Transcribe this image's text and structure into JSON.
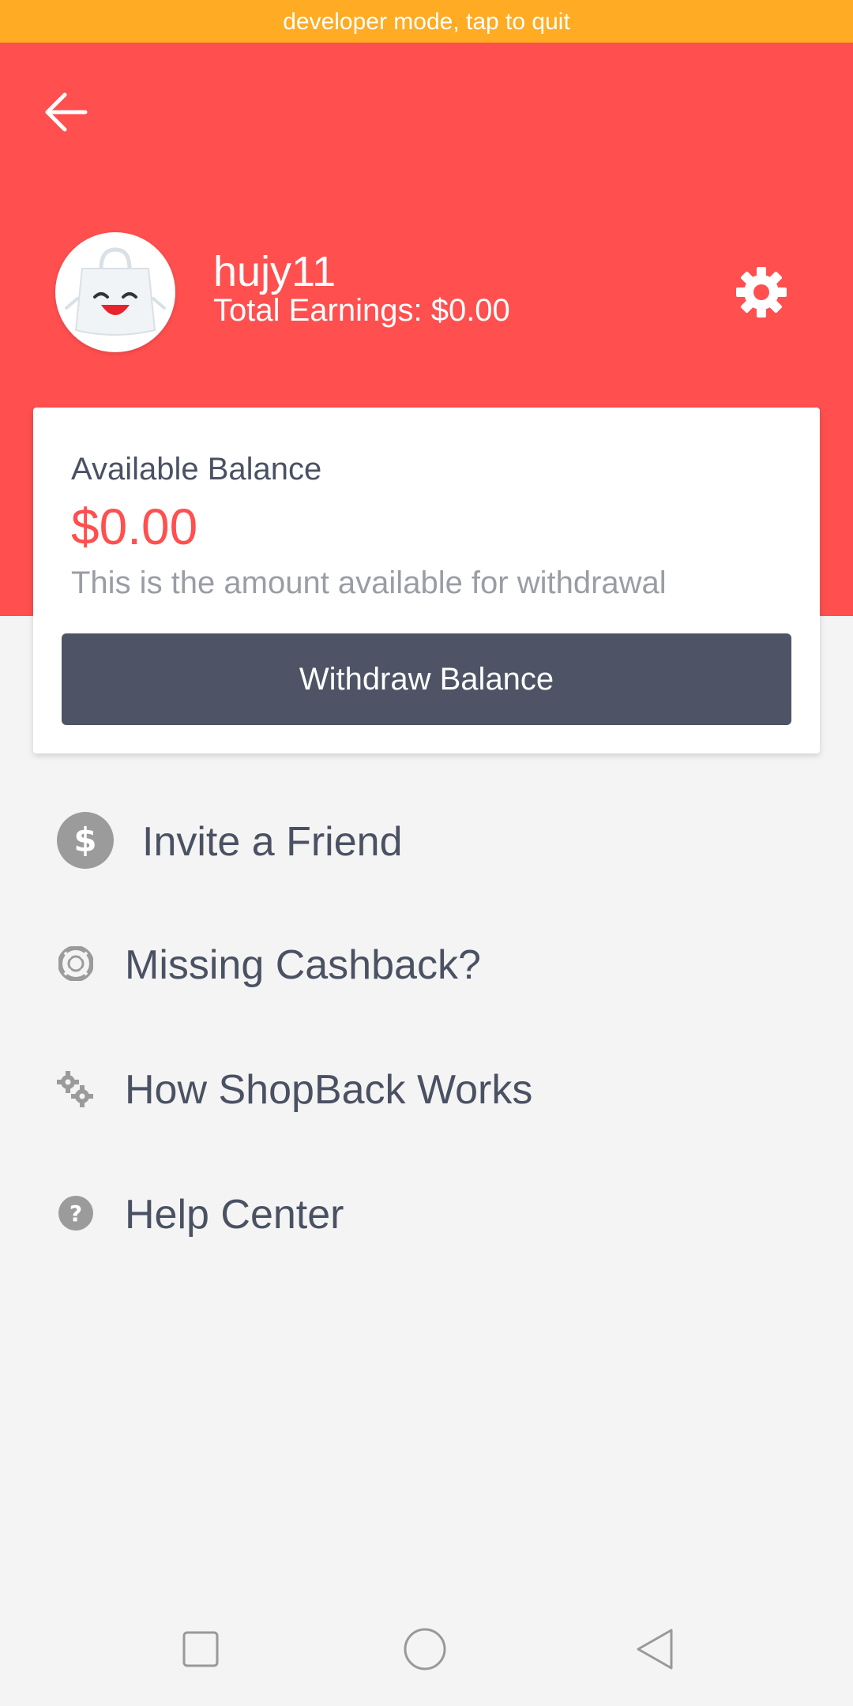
{
  "dev_banner": "developer mode, tap to quit",
  "colors": {
    "brand_red": "#ff4f4f",
    "dev_orange": "#ffab23",
    "button_dark": "#4e5466"
  },
  "header": {
    "back_icon": "arrow-left-icon",
    "username": "hujy11",
    "total_earnings": "Total Earnings: $0.00",
    "settings_icon": "gear-icon"
  },
  "balance_card": {
    "title": "Available Balance",
    "amount": "$0.00",
    "note": "This is the amount available for withdrawal",
    "button_label": "Withdraw Balance"
  },
  "menu": {
    "items": [
      {
        "label": "Invite a Friend",
        "icon": "dollar-circle-icon"
      },
      {
        "label": "Missing Cashback?",
        "icon": "lifebuoy-icon"
      },
      {
        "label": "How ShopBack Works",
        "icon": "gears-icon"
      },
      {
        "label": "Help Center",
        "icon": "question-circle-icon"
      }
    ]
  },
  "navbar": {
    "icons": [
      "recent-apps-icon",
      "home-icon",
      "back-triangle-icon"
    ]
  }
}
